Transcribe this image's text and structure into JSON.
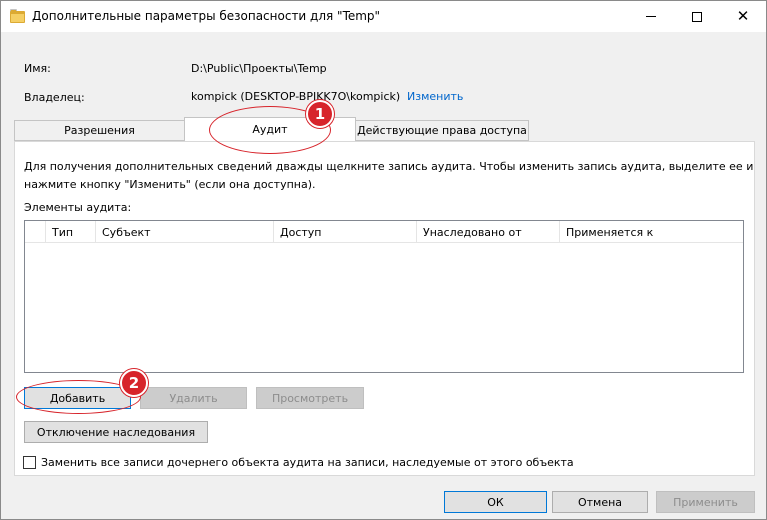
{
  "window": {
    "title": "Дополнительные параметры безопасности  для \"Temp\"",
    "minimize_icon": "minimize-icon",
    "maximize_icon": "maximize-icon",
    "close_icon": "close-icon",
    "close_glyph": "✕"
  },
  "info": {
    "name_label": "Имя:",
    "name_value": "D:\\Public\\Проекты\\Temp",
    "owner_label": "Владелец:",
    "owner_value": "kompick (DESKTOP-BPIKK7O\\kompick)",
    "change_link": "Изменить"
  },
  "tabs": [
    {
      "label": "Разрешения"
    },
    {
      "label": "Аудит"
    },
    {
      "label": "Действующие права доступа"
    }
  ],
  "active_tab": "Аудит",
  "audit": {
    "description_line1": "Для получения дополнительных сведений дважды щелкните запись аудита. Чтобы изменить запись аудита, выделите ее и",
    "description_line2": "нажмите кнопку \"Изменить\" (если она доступна).",
    "entries_label": "Элементы аудита:",
    "columns": [
      "Тип",
      "Субъект",
      "Доступ",
      "Унаследовано от",
      "Применяется к"
    ],
    "rows": []
  },
  "buttons": {
    "add": "Добавить",
    "remove": "Удалить",
    "view": "Просмотреть",
    "disable_inheritance": "Отключение наследования",
    "ok": "ОК",
    "cancel": "Отмена",
    "apply": "Применить"
  },
  "replace_checkbox": {
    "label": "Заменить все записи дочернего объекта аудита на записи, наследуемые от этого объекта",
    "checked": false
  },
  "annotations": {
    "badge1": "1",
    "badge2": "2",
    "color": "#d7242b"
  }
}
